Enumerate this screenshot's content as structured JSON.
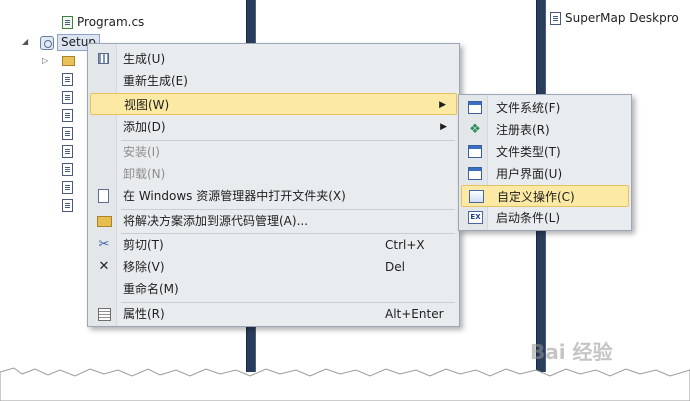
{
  "solution_tree": {
    "program_file": "Program.cs",
    "setup_node": "Setup"
  },
  "right_pane": {
    "item": "SuperMap Deskpro"
  },
  "context_menu": {
    "items": [
      {
        "label": "生成(U)",
        "icon": "build-icon"
      },
      {
        "label": "重新生成(E)",
        "icon": ""
      },
      {
        "label": "视图(W)",
        "icon": "",
        "submenu": true
      },
      {
        "label": "添加(D)",
        "icon": "",
        "submenu": true
      },
      {
        "label": "安装(I)",
        "icon": "",
        "disabled": true
      },
      {
        "label": "卸载(N)",
        "icon": "",
        "disabled": true
      },
      {
        "label": "在 Windows 资源管理器中打开文件夹(X)",
        "icon": "open-folder-icon"
      },
      {
        "label": "将解决方案添加到源代码管理(A)...",
        "icon": "source-control-icon"
      },
      {
        "label": "剪切(T)",
        "icon": "scissors-icon",
        "shortcut": "Ctrl+X"
      },
      {
        "label": "移除(V)",
        "icon": "remove-x-icon",
        "shortcut": "Del"
      },
      {
        "label": "重命名(M)",
        "icon": ""
      },
      {
        "label": "属性(R)",
        "icon": "properties-icon",
        "shortcut": "Alt+Enter"
      }
    ]
  },
  "view_submenu": {
    "items": [
      {
        "label": "文件系统(F)",
        "icon": "file-system-icon"
      },
      {
        "label": "注册表(R)",
        "icon": "registry-icon"
      },
      {
        "label": "文件类型(T)",
        "icon": "file-types-icon"
      },
      {
        "label": "用户界面(U)",
        "icon": "user-interface-icon"
      },
      {
        "label": "自定义操作(C)",
        "icon": "custom-actions-icon",
        "highlighted": true
      },
      {
        "label": "启动条件(L)",
        "icon": "launch-conditions-icon"
      }
    ]
  },
  "watermark": "Bai 经验",
  "colors": {
    "menu_bg": "#e9ecee",
    "highlight": "#fbe9a4",
    "splitter": "#2b3d5c"
  }
}
